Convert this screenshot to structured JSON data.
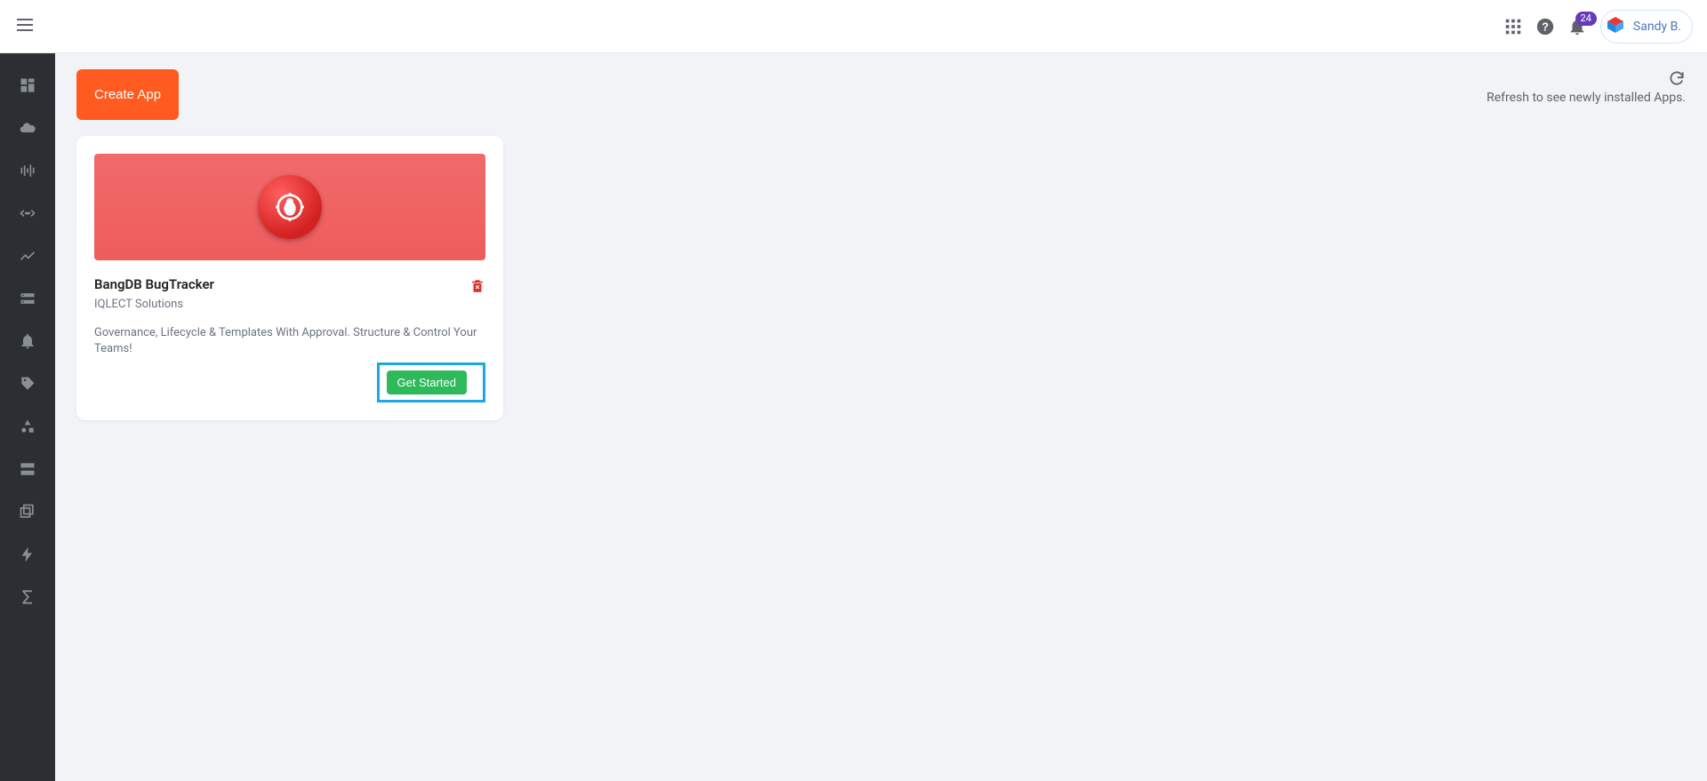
{
  "header": {
    "notification_count": "24",
    "profile_name": "Sandy B."
  },
  "main": {
    "create_button": "Create App",
    "refresh_hint": "Refresh to see newly installed Apps."
  },
  "app_card": {
    "title": "BangDB BugTracker",
    "vendor": "IQLECT Solutions",
    "description": "Governance, Lifecycle & Templates With Approval. Structure & Control Your Teams!",
    "action": "Get Started"
  }
}
